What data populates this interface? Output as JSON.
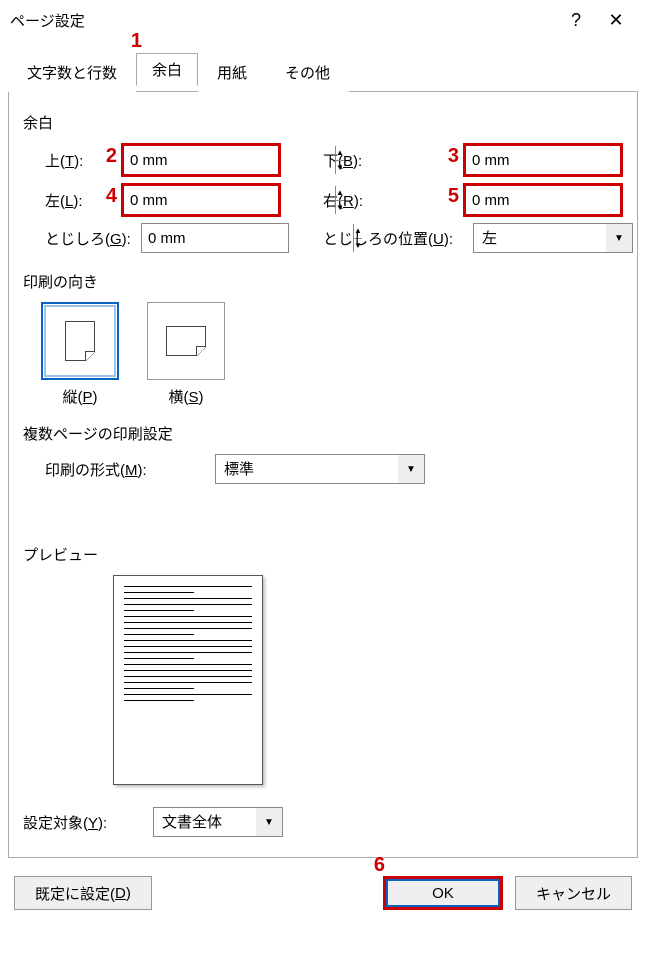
{
  "dialog": {
    "title": "ページ設定"
  },
  "tabs": {
    "t0": "文字数と行数",
    "t1": "余白",
    "t2": "用紙",
    "t3": "その他"
  },
  "annotations": {
    "a1": "1",
    "a2": "2",
    "a3": "3",
    "a4": "4",
    "a5": "5",
    "a6": "6"
  },
  "margins": {
    "section_label": "余白",
    "top_label_pre": "上(",
    "top_key": "T",
    "top_label_post": "):",
    "bottom_label_pre": "下(",
    "bottom_key": "B",
    "bottom_label_post": "):",
    "left_label_pre": "左(",
    "left_key": "L",
    "left_label_post": "):",
    "right_label_pre": "右(",
    "right_key": "R",
    "right_label_post": "):",
    "gutter_label_pre": "とじしろ(",
    "gutter_key": "G",
    "gutter_label_post": "):",
    "gutterpos_label_pre": "とじしろの位置(",
    "gutterpos_key": "U",
    "gutterpos_label_post": "):",
    "top_value": "0 mm",
    "bottom_value": "0 mm",
    "left_value": "0 mm",
    "right_value": "0 mm",
    "gutter_value": "0 mm",
    "gutterpos_value": "左"
  },
  "orientation": {
    "section_label": "印刷の向き",
    "portrait_pre": "縦(",
    "portrait_key": "P",
    "portrait_post": ")",
    "landscape_pre": "横(",
    "landscape_key": "S",
    "landscape_post": ")"
  },
  "multipage": {
    "section_label": "複数ページの印刷設定",
    "layout_label_pre": "印刷の形式(",
    "layout_key": "M",
    "layout_label_post": "):",
    "layout_value": "標準"
  },
  "preview": {
    "section_label": "プレビュー"
  },
  "apply": {
    "label_pre": "設定対象(",
    "key": "Y",
    "label_post": "):",
    "value": "文書全体"
  },
  "footer": {
    "default_pre": "既定に設定(",
    "default_key": "D",
    "default_post": ")",
    "ok": "OK",
    "cancel": "キャンセル"
  }
}
